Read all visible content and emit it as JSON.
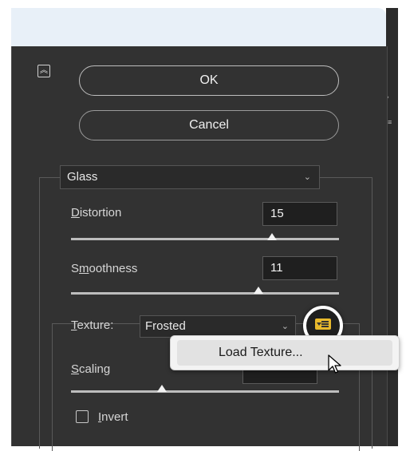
{
  "dialog": {
    "ok_label": "OK",
    "cancel_label": "Cancel",
    "filter": {
      "selected": "Glass"
    },
    "distortion": {
      "label_prefix": "",
      "label_underlined": "D",
      "label_rest": "istortion",
      "value": "15",
      "slider_fraction": 0.75
    },
    "smoothness": {
      "label_prefix": "S",
      "label_underlined": "m",
      "label_rest": "oothness",
      "value": "11",
      "slider_fraction": 0.7
    },
    "texture": {
      "label_underlined": "T",
      "label_rest": "exture:",
      "selected": "Frosted"
    },
    "scaling": {
      "label_underlined": "S",
      "label_rest": "caling",
      "slider_fraction": 0.34
    },
    "invert": {
      "label_underlined": "I",
      "label_rest": "nvert",
      "checked": false
    }
  },
  "popup_menu": {
    "item_label": "Load Texture..."
  },
  "icons": {
    "collapse": "double-chevron-up-icon",
    "dropdown": "chevron-down-icon",
    "texture_menu": "texture-menu-icon",
    "cursor": "mouse-pointer-icon"
  },
  "colors": {
    "accent": "#e8b92c",
    "panel": "#323232"
  }
}
